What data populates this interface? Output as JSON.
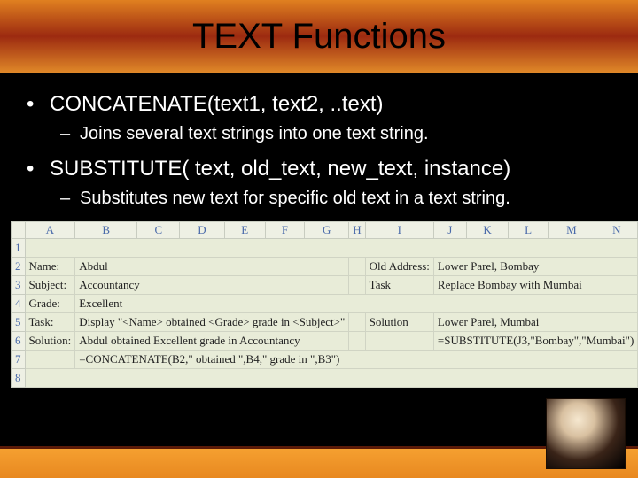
{
  "title": "TEXT Functions",
  "bullets": [
    {
      "main": "CONCATENATE(text1, text2, ..text)",
      "sub": "Joins several text strings into one text string."
    },
    {
      "main": "SUBSTITUTE( text, old_text, new_text, instance)",
      "sub": "Substitutes new text for specific old text in a text string."
    }
  ],
  "sheet": {
    "cols": [
      "A",
      "B",
      "C",
      "D",
      "E",
      "F",
      "G",
      "H",
      "I",
      "J",
      "K",
      "L",
      "M",
      "N"
    ],
    "rows": [
      "1",
      "2",
      "3",
      "4",
      "5",
      "6",
      "7",
      "8"
    ],
    "cells": {
      "A2": "Name:",
      "B2": "Abdul",
      "A3": "Subject:",
      "B3": "Accountancy",
      "A4": "Grade:",
      "B4": "Excellent",
      "A5": "Task:",
      "B5": "Display \"<Name> obtained <Grade> grade in <Subject>\"",
      "A6": "Solution:",
      "B6": "Abdul obtained Excellent grade in Accountancy",
      "B7": "=CONCATENATE(B2,\" obtained \",B4,\" grade in \",B3\")",
      "I2": "Old Address:",
      "J2": "Lower Parel, Bombay",
      "I3": "Task",
      "J3": "Replace Bombay with Mumbai",
      "I5": "Solution",
      "J5": "Lower Parel, Mumbai",
      "J6": "=SUBSTITUTE(J3,\"Bombay\",\"Mumbai\")"
    }
  }
}
